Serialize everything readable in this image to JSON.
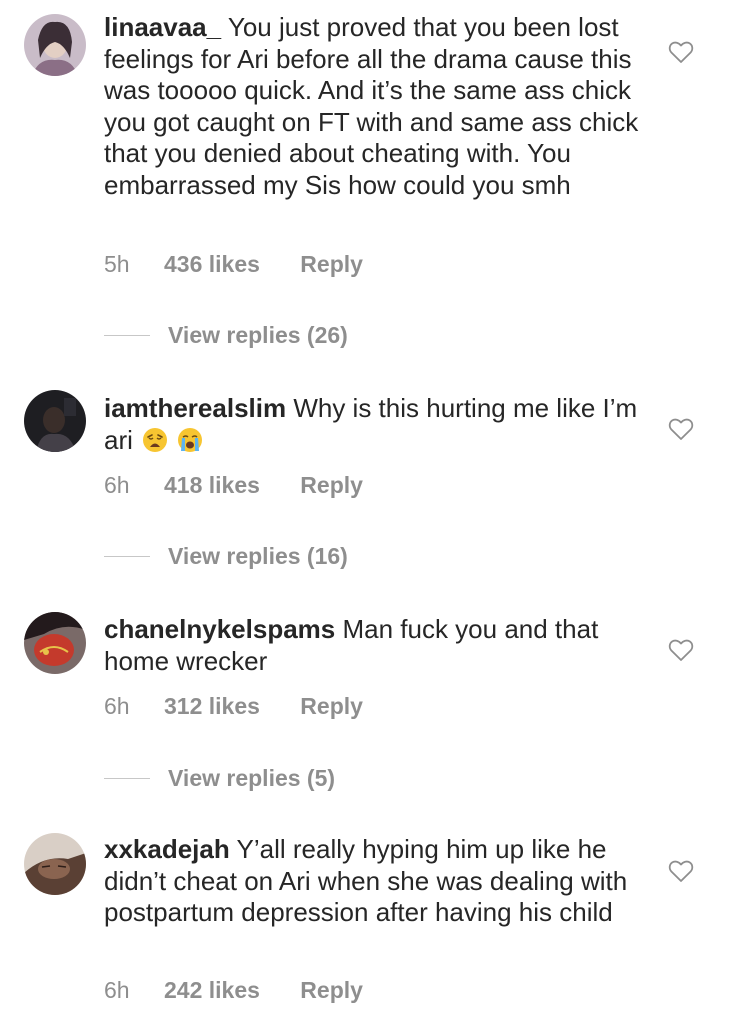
{
  "comments": [
    {
      "username": "linaavaa_",
      "text": "You just proved that you been lost feelings for Ari before all the drama cause this was tooooo quick. And it’s the same ass chick you got caught on FT with and same ass chick that you denied about cheating with. You embarrassed my Sis how could you smh",
      "time": "5h",
      "likes": "436 likes",
      "reply": "Reply",
      "view_replies": "View replies (26)",
      "avatar_color": "#b9a7b8"
    },
    {
      "username": "iamtherealslim",
      "text": "Why is this hurting me like I’m ari",
      "emojis": [
        "weary-face-emoji",
        "loudly-crying-face-emoji"
      ],
      "time": "6h",
      "likes": "418 likes",
      "reply": "Reply",
      "view_replies": "View replies (16)",
      "avatar_color": "#2a2a2e"
    },
    {
      "username": "chanelnykelspams",
      "text": "Man fuck you and that home wrecker",
      "time": "6h",
      "likes": "312 likes",
      "reply": "Reply",
      "view_replies": "View replies (5)",
      "avatar_color": "#c0392b"
    },
    {
      "username": "xxkadejah",
      "text": "Y’all really hyping him up like he didn’t cheat on Ari when she was dealing with postpartum depression after having his child",
      "time": "6h",
      "likes": "242 likes",
      "reply": "Reply",
      "avatar_color": "#6b4f3f"
    }
  ],
  "icons": {
    "like": "heart-outline-icon"
  },
  "colors": {
    "text": "#262626",
    "secondary": "#8e8e8e"
  }
}
